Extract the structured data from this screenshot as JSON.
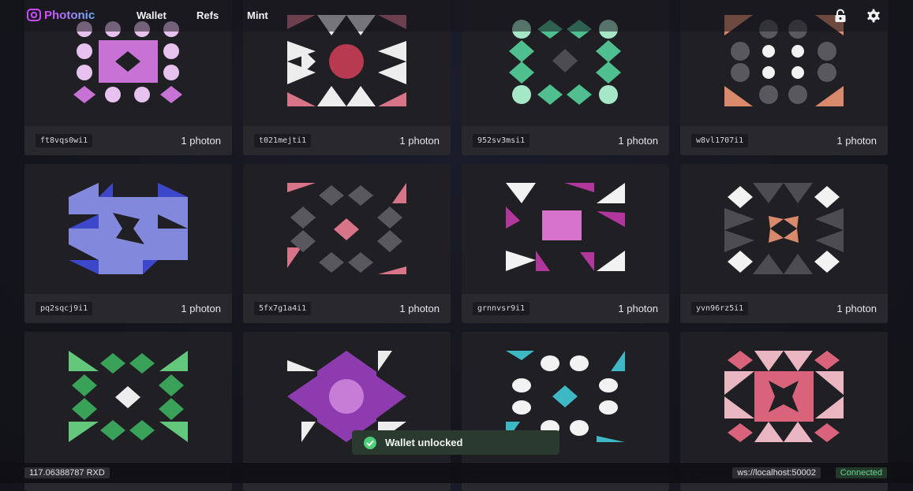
{
  "app": {
    "name": "Photonic"
  },
  "nav": [
    {
      "label": "Wallet"
    },
    {
      "label": "Refs"
    },
    {
      "label": "Mint"
    }
  ],
  "top_icons": [
    "lock-icon",
    "settings-gear-icon"
  ],
  "tokens": [
    {
      "ref": "ft8vqs0wi1",
      "price": "1 photon"
    },
    {
      "ref": "t021mejti1",
      "price": "1 photon"
    },
    {
      "ref": "952sv3msi1",
      "price": "1 photon"
    },
    {
      "ref": "w8vl1707i1",
      "price": "1 photon"
    },
    {
      "ref": "pq2sqcj9i1",
      "price": "1 photon"
    },
    {
      "ref": "5fx7g1a4i1",
      "price": "1 photon"
    },
    {
      "ref": "grnnvsr9i1",
      "price": "1 photon"
    },
    {
      "ref": "yvn96rz5i1",
      "price": "1 photon"
    },
    {
      "ref": "",
      "price": ""
    },
    {
      "ref": "",
      "price": ""
    },
    {
      "ref": "",
      "price": ""
    },
    {
      "ref": "",
      "price": ""
    }
  ],
  "status": {
    "balance": "117.06388787 RXD",
    "server": "ws://localhost:50002",
    "connection": "Connected"
  },
  "toast": {
    "message": "Wallet unlocked"
  },
  "colors": {
    "accent_purple": "#c86bd6",
    "connected_green": "#69d292",
    "toast_bg": "#2a3a2e"
  }
}
